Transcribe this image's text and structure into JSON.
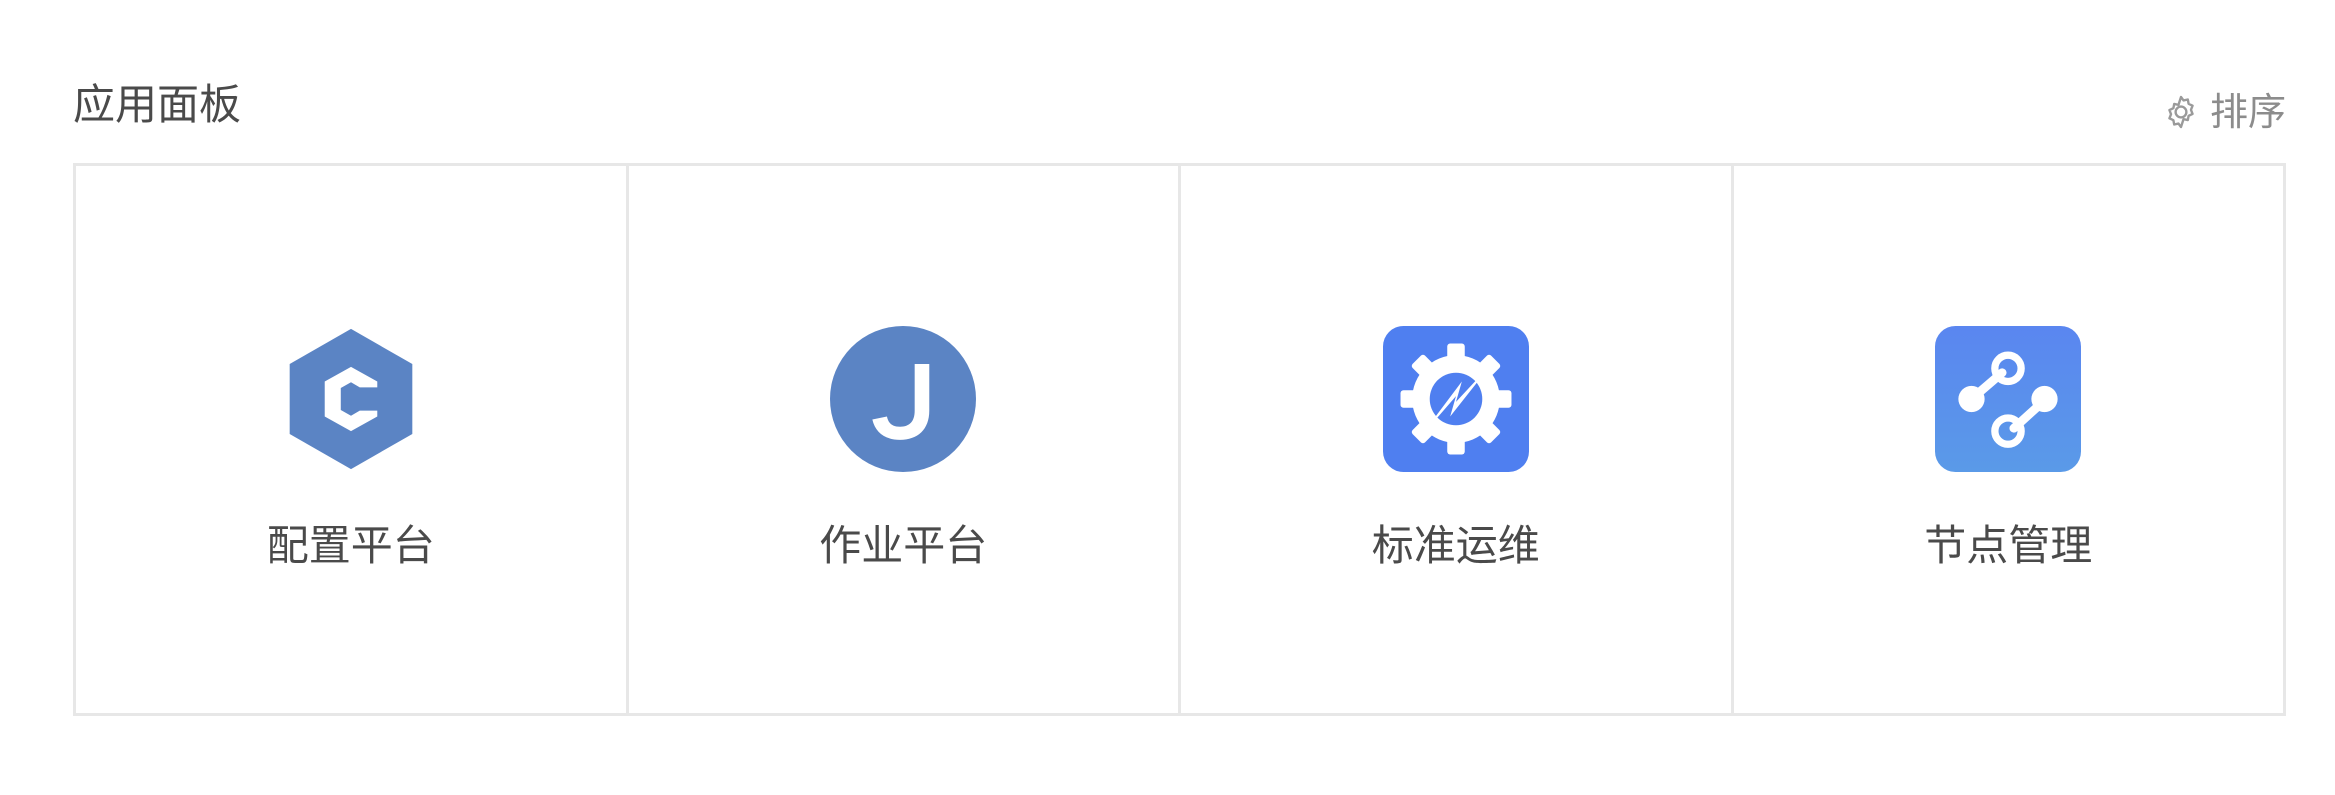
{
  "panel": {
    "title": "应用面板",
    "sort_icon": "gear-icon",
    "sort_label": "排序"
  },
  "apps": [
    {
      "label": "配置平台",
      "icon": "hexagon-c-icon",
      "color": "#5b84c4"
    },
    {
      "label": "作业平台",
      "icon": "circle-j-icon",
      "color": "#5b84c4"
    },
    {
      "label": "标准运维",
      "icon": "gear-lightning-icon",
      "color": "#4f7ff0"
    },
    {
      "label": "节点管理",
      "icon": "node-link-icon",
      "color": "#5a8ff2"
    }
  ]
}
